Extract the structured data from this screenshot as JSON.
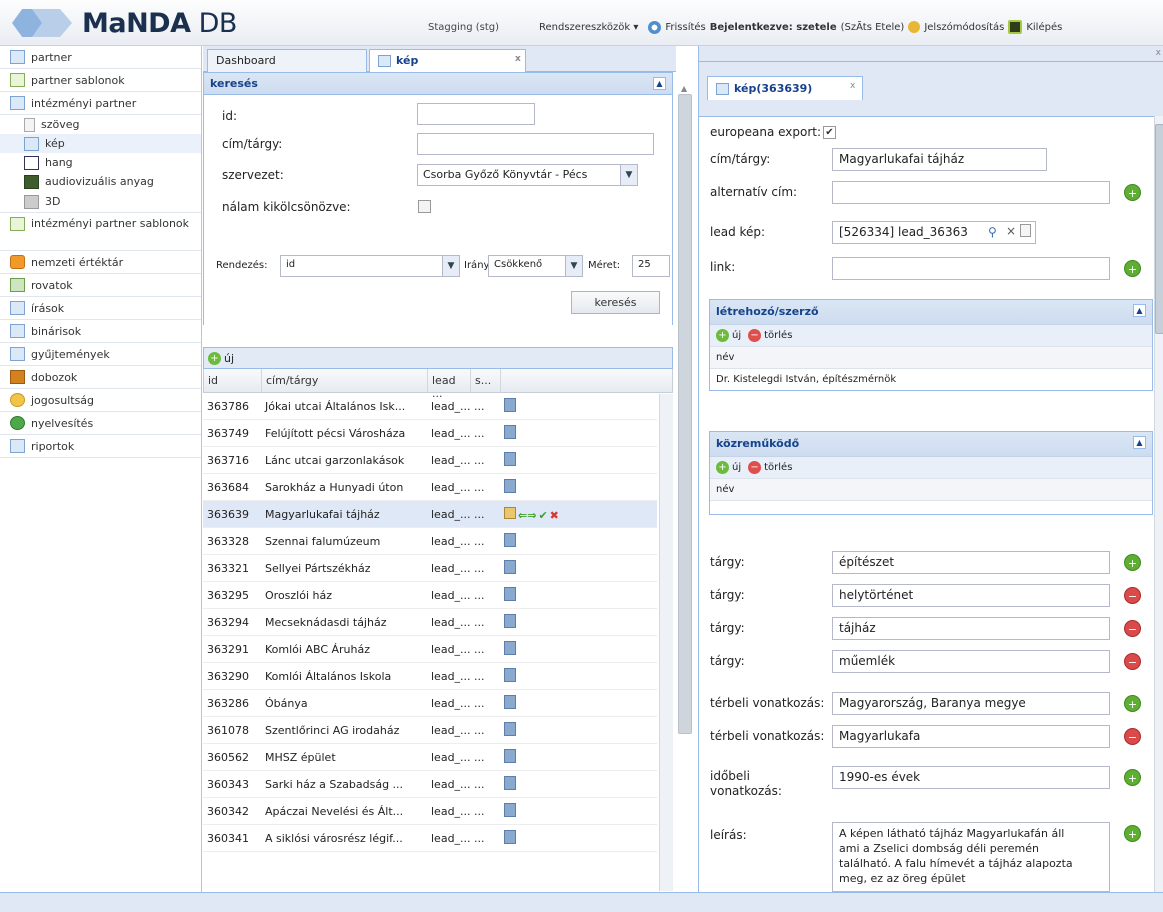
{
  "app": {
    "logo_text_bold": "MaNDA",
    "logo_text_light": " DB",
    "environment": "Stagging (stg)",
    "tools_menu": "Rendszereszközök ▾",
    "refresh": "Frissítés",
    "logged_in_label": "Bejelentkezve: szetele",
    "logged_in_name": "(SzÃ­ts Etele)",
    "password_change": "Jelszómódosítás",
    "logout": "Kilépés"
  },
  "sidebar": {
    "items": [
      {
        "label": "partner"
      },
      {
        "label": "partner sablonok"
      },
      {
        "label": "intézményi partner"
      },
      {
        "label": "szöveg"
      },
      {
        "label": "kép"
      },
      {
        "label": "hang"
      },
      {
        "label": "audiovizuális anyag"
      },
      {
        "label": "3D"
      },
      {
        "label": "intézményi partner sablonok"
      },
      {
        "label": "nemzeti értéktár"
      },
      {
        "label": "rovatok"
      },
      {
        "label": "írások"
      },
      {
        "label": "binárisok"
      },
      {
        "label": "gyűjtemények"
      },
      {
        "label": "dobozok"
      },
      {
        "label": "jogosultság"
      },
      {
        "label": "nyelvesítés"
      },
      {
        "label": "riportok"
      }
    ]
  },
  "tabs": {
    "dashboard": "Dashboard",
    "kep": "kép",
    "close": "x"
  },
  "search": {
    "title": "keresés",
    "id_label": "id:",
    "id_value": "",
    "title_label": "cím/tárgy:",
    "title_value": "",
    "org_label": "szervezet:",
    "org_value": "Csorba Győző Könyvtár - Pécs",
    "borrowed_label": "nálam kikölcsönözve:",
    "sort_label": "Rendezés:",
    "sort_value": "id",
    "dir_label": "Irány:",
    "dir_value": "Csökkenő",
    "size_label": "Méret:",
    "size_value": "25",
    "button": "keresés"
  },
  "grid": {
    "new_label": "új",
    "columns": [
      "id",
      "cím/tárgy",
      "lead ...",
      "s..."
    ],
    "rows": [
      {
        "id": "363786",
        "title": "Jókai utcai Általános Isk...",
        "lead": "lead_...",
        "s": "..."
      },
      {
        "id": "363749",
        "title": "Felújított pécsi Városháza",
        "lead": "lead_...",
        "s": "..."
      },
      {
        "id": "363716",
        "title": "Lánc utcai garzonlakások",
        "lead": "lead_...",
        "s": "..."
      },
      {
        "id": "363684",
        "title": "Sarokház a Hunyadi úton",
        "lead": "lead_...",
        "s": "..."
      },
      {
        "id": "363639",
        "title": "Magyarlukafai tájház",
        "lead": "lead_...",
        "s": "..."
      },
      {
        "id": "363328",
        "title": "Szennai falumúzeum",
        "lead": "lead_...",
        "s": "..."
      },
      {
        "id": "363321",
        "title": "Sellyei Pártszékház",
        "lead": "lead_...",
        "s": "..."
      },
      {
        "id": "363295",
        "title": "Oroszlói ház",
        "lead": "lead_...",
        "s": "..."
      },
      {
        "id": "363294",
        "title": "Mecseknádasdi tájház",
        "lead": "lead_...",
        "s": "..."
      },
      {
        "id": "363291",
        "title": "Komlói ABC Áruház",
        "lead": "lead_...",
        "s": "..."
      },
      {
        "id": "363290",
        "title": "Komlói Általános Iskola",
        "lead": "lead_...",
        "s": "..."
      },
      {
        "id": "363286",
        "title": "Óbánya",
        "lead": "lead_...",
        "s": "..."
      },
      {
        "id": "361078",
        "title": "Szentlőrinci AG irodaház",
        "lead": "lead_...",
        "s": "..."
      },
      {
        "id": "360562",
        "title": "MHSZ épület",
        "lead": "lead_...",
        "s": "..."
      },
      {
        "id": "360343",
        "title": "Sarki ház a Szabadság ...",
        "lead": "lead_...",
        "s": "..."
      },
      {
        "id": "360342",
        "title": "Apáczai Nevelési és Ált...",
        "lead": "lead_...",
        "s": "..."
      },
      {
        "id": "360341",
        "title": "A siklósi városrész légif...",
        "lead": "lead_...",
        "s": "..."
      }
    ]
  },
  "detail": {
    "tab": "kép(363639)",
    "europeana_label": "europeana export:",
    "title_label": "cím/tárgy:",
    "title_value": "Magyarlukafai tájház",
    "alt_title_label": "alternatív cím:",
    "alt_title_value": "",
    "lead_label": "lead kép:",
    "lead_value": "[526334] lead_36363",
    "link_label": "link:",
    "link_value": "",
    "creator_title": "létrehozó/szerző",
    "new_label": "új",
    "delete_label": "törlés",
    "name_header": "név",
    "creator_value": "Dr. Kistelegdi István, építészmérnök",
    "contributor_title": "közreműködő",
    "subject_label": "tárgy:",
    "subjects": [
      "építészet",
      "helytörténet",
      "tájház",
      "műemlék"
    ],
    "spatial_label": "térbeli vonatkozás:",
    "spatial": [
      "Magyarország, Baranya megye",
      "Magyarlukafa"
    ],
    "temporal_label_1": "időbeli",
    "temporal_label_2": "vonatkozás:",
    "temporal_value": "1990-es évek",
    "desc_label": "leírás:",
    "desc_value": "A képen látható tájház Magyarlukafán áll ami a Zselici dombság déli peremén található. A falu hímevét a tájház alapozta meg, ez az öreg épület"
  },
  "colors": {
    "accent": "#15428b",
    "border": "#99bbe8",
    "add": "#5fae34",
    "remove": "#d94a4a"
  }
}
